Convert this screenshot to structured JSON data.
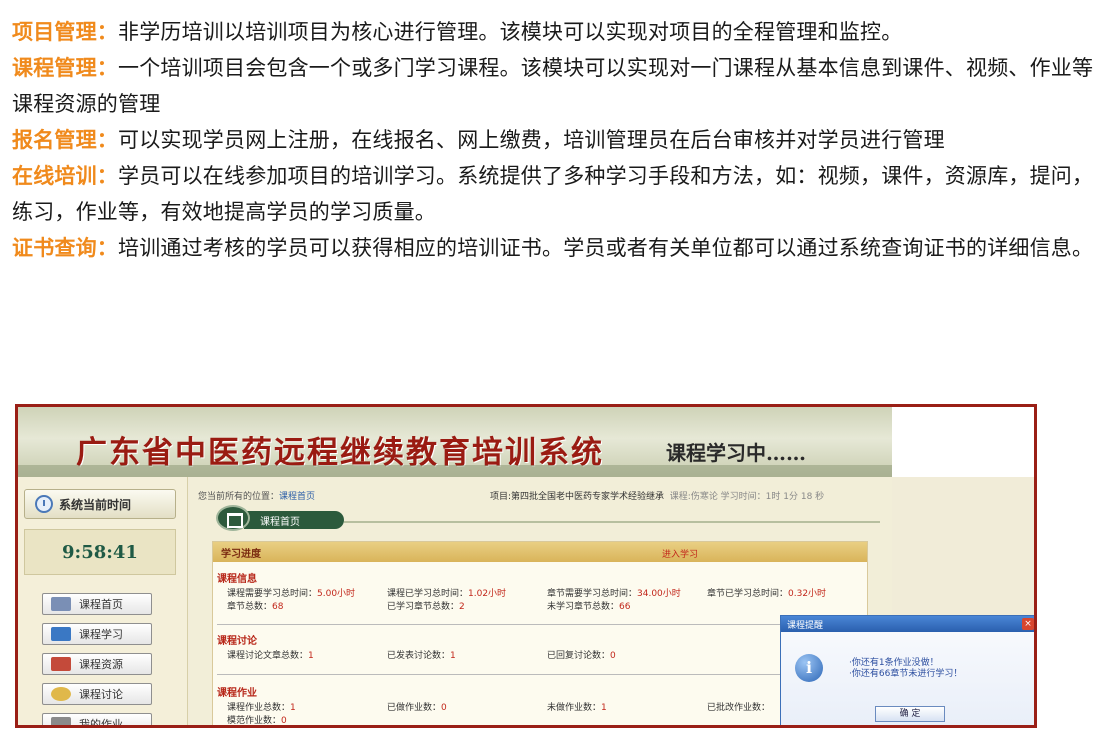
{
  "paragraphs": [
    {
      "term": "项目管理：",
      "body": "非学历培训以培训项目为核心进行管理。该模块可以实现对项目的全程管理和监控。"
    },
    {
      "term": "课程管理：",
      "body": "一个培训项目会包含一个或多门学习课程。该模块可以实现对一门课程从基本信息到课件、视频、作业等课程资源的管理"
    },
    {
      "term": "报名管理：",
      "body": "可以实现学员网上注册，在线报名、网上缴费，培训管理员在后台审核并对学员进行管理"
    },
    {
      "term": "在线培训：",
      "body": "学员可以在线参加项目的培训学习。系统提供了多种学习手段和方法，如：视频，课件，资源库，提问，练习，作业等，有效地提高学员的学习质量。"
    },
    {
      "term": "证书查询：",
      "body": "培训通过考核的学员可以获得相应的培训证书。学员或者有关单位都可以通过系统查询证书的详细信息。"
    }
  ],
  "app": {
    "title": "广东省中医药远程继续教育培训系统",
    "subtitle": "课程学习中……",
    "sidebar": {
      "time_label": "系统当前时间",
      "time_value": "9:58:41",
      "items": [
        {
          "label": "课程首页",
          "icon": "book-icon",
          "color": "#7a8fb5"
        },
        {
          "label": "课程学习",
          "icon": "computer-icon",
          "color": "#3a78c4"
        },
        {
          "label": "课程资源",
          "icon": "books-stack-icon",
          "color": "#c44a3a"
        },
        {
          "label": "课程讨论",
          "icon": "speech-bubble-icon",
          "color": "#e0b84a"
        },
        {
          "label": "我的作业",
          "icon": "notebook-icon",
          "color": "#8a8a8a"
        }
      ]
    },
    "breadcrumb_prefix": "您当前所有的位置：",
    "breadcrumb_link": "课程首页",
    "project_info": "项目:第四批全国老中医药专家学术经验继承",
    "course_info": "课程:伤寒论  学习时间：1时 1分 18 秒",
    "home_tab": "课程首页",
    "progress_title": "学习进度",
    "sections": {
      "info": {
        "title": "课程信息",
        "rows": [
          [
            {
              "k": "课程需要学习总时间：",
              "v": "5.00小时"
            },
            {
              "k": "课程已学习总时间：",
              "v": "1.02小时"
            },
            {
              "k": "章节需要学习总时间：",
              "v": "34.00小时"
            },
            {
              "k": "章节已学习总时间：",
              "v": "0.32小时"
            }
          ],
          [
            {
              "k": "章节总数：",
              "v": "68"
            },
            {
              "k": "已学习章节总数：",
              "v": "2"
            },
            {
              "k": "未学习章节总数：",
              "v": "66"
            }
          ]
        ]
      },
      "discussion": {
        "title": "课程讨论",
        "rows": [
          [
            {
              "k": "课程讨论文章总数：",
              "v": "1"
            },
            {
              "k": "已发表讨论数：",
              "v": "1"
            },
            {
              "k": "已回复讨论数：",
              "v": "0"
            }
          ]
        ]
      },
      "homework": {
        "title": "课程作业",
        "rows": [
          [
            {
              "k": "课程作业总数：",
              "v": "1"
            },
            {
              "k": "已做作业数：",
              "v": "0"
            },
            {
              "k": "未做作业数：",
              "v": "1"
            },
            {
              "k": "已批改作业数：",
              "v": ""
            }
          ],
          [
            {
              "k": "模范作业数：",
              "v": "0"
            }
          ]
        ]
      }
    },
    "partial_link": "进入学习",
    "popup": {
      "title": "课程提醒",
      "close": "×",
      "messages": [
        "·你还有1条作业没做！",
        "·你还有66章节未进行学习！"
      ],
      "ok": "确 定"
    }
  }
}
